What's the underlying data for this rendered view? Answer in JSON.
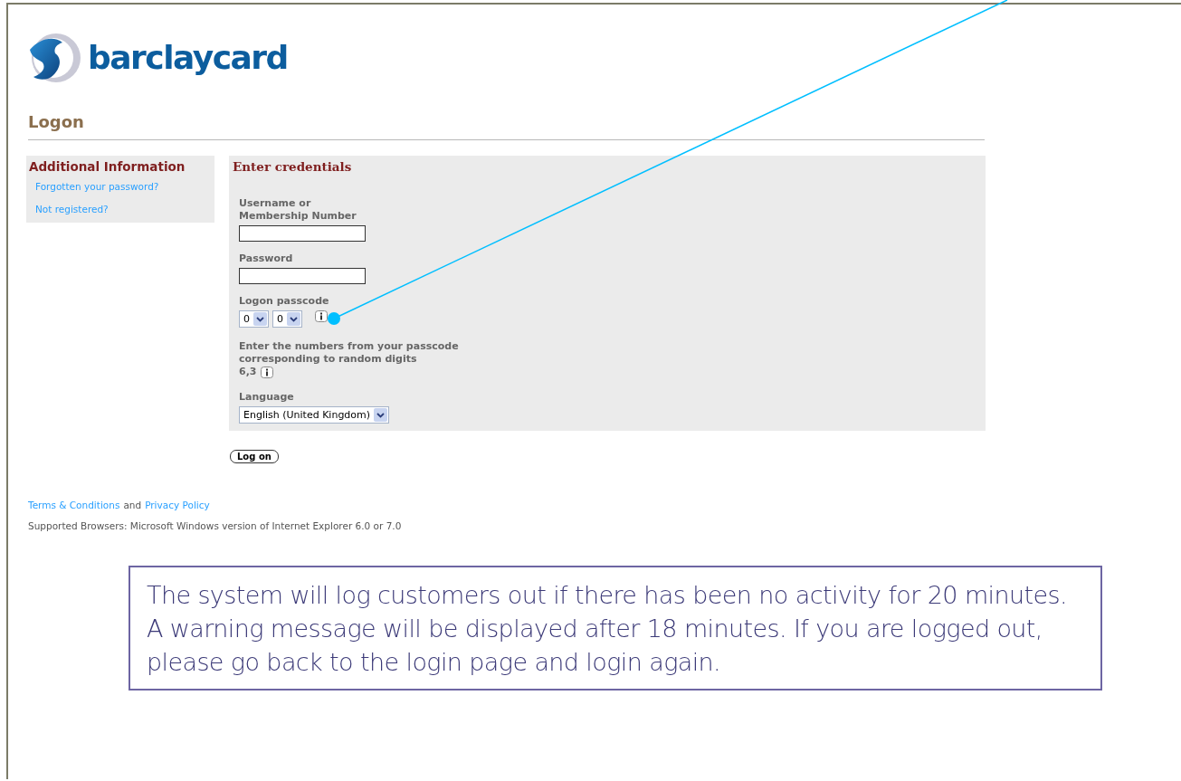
{
  "logo": {
    "text": "barclaycard"
  },
  "page_title": "Logon",
  "sidebar": {
    "title": "Additional Information",
    "links": [
      "Forgotten your password?",
      "Not registered?"
    ]
  },
  "credentials": {
    "title": "Enter credentials",
    "username": {
      "label_lines": [
        "Username or",
        "Membership Number"
      ]
    },
    "password": {
      "label": "Password"
    },
    "passcode": {
      "label": "Logon passcode",
      "selects": [
        "0",
        "0"
      ],
      "help": [
        "Enter the numbers from your passcode",
        "corresponding to random digits"
      ],
      "digits": "6,3"
    },
    "language": {
      "label": "Language",
      "value": "English (United Kingdom)"
    }
  },
  "logon_button": "Log on",
  "footer": {
    "terms_link": "Terms & Conditions",
    "joiner": "and",
    "privacy_link": "Privacy Policy",
    "browsers": "Supported Browsers: Microsoft Windows version of Internet Explorer 6.0 or 7.0"
  },
  "annotation": {
    "text": "The system will log customers out if there has been no activity for 20 minutes. A warning message will be displayed after 18 minutes. If you are logged out, please go back to the login page and login again."
  }
}
